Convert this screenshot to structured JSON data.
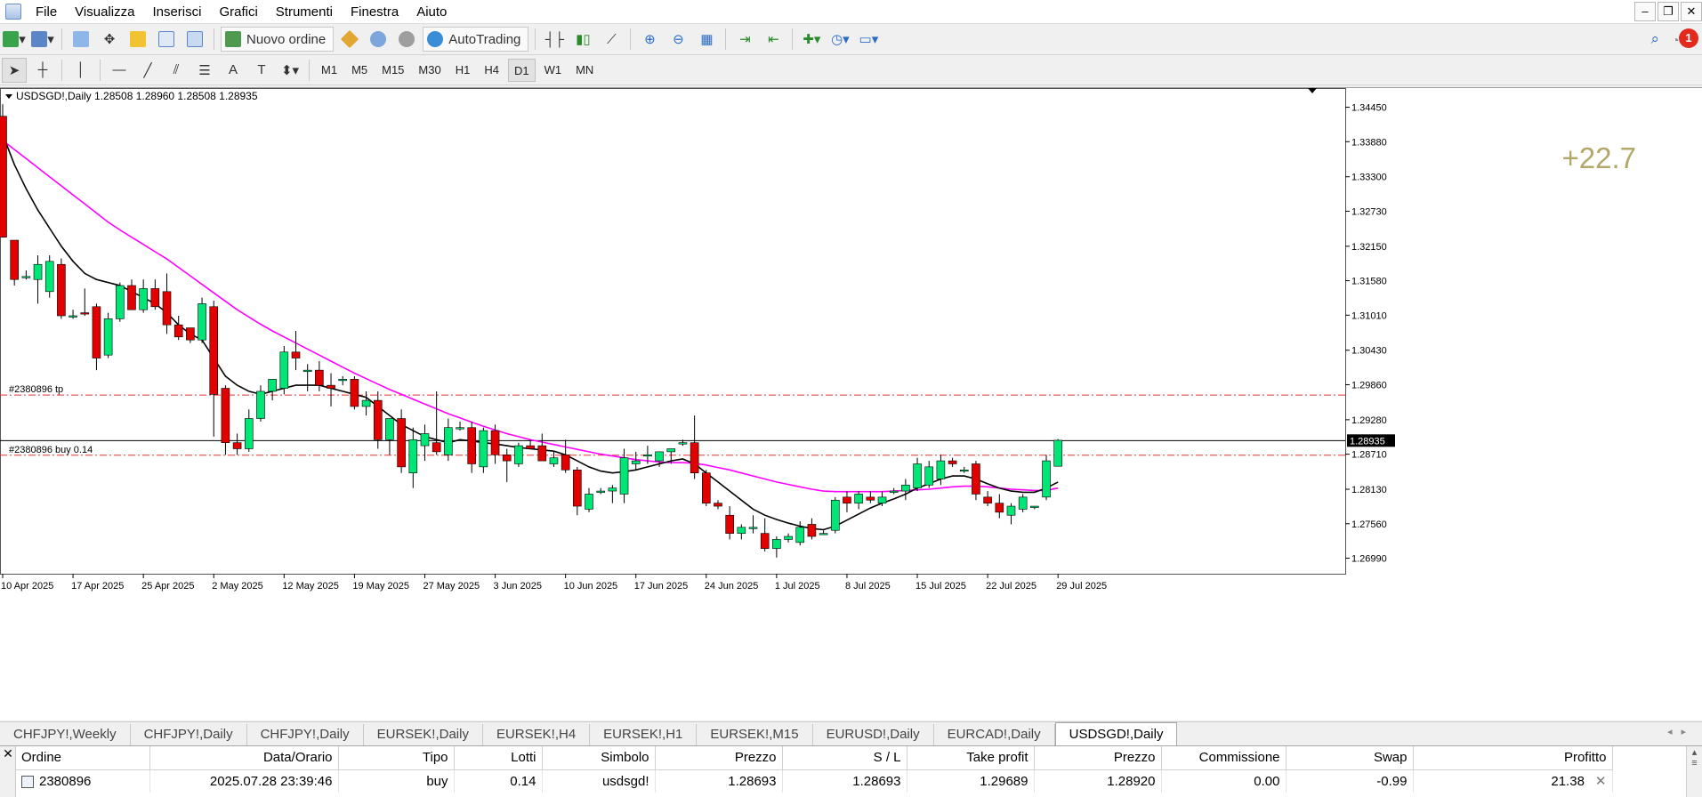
{
  "menu": {
    "items": [
      "File",
      "Visualizza",
      "Inserisci",
      "Grafici",
      "Strumenti",
      "Finestra",
      "Aiuto"
    ]
  },
  "window_buttons": [
    "minimize-icon",
    "restore-icon",
    "close-icon"
  ],
  "toolbar1": {
    "new_order_label": "Nuovo ordine",
    "autotrading_label": "AutoTrading",
    "notification_count": "1"
  },
  "toolbar2": {
    "timeframes": [
      "M1",
      "M5",
      "M15",
      "M30",
      "H1",
      "H4",
      "D1",
      "W1",
      "MN"
    ],
    "active_timeframe": "D1"
  },
  "chart": {
    "header": "USDSGD!,Daily  1.28508 1.28960 1.28508 1.28935",
    "profit_label": "+22.7",
    "tp_label": "#2380896 tp",
    "buy_label": "#2380896 buy 0.14",
    "current_price": "1.28935"
  },
  "chart_data": {
    "type": "candlestick",
    "symbol": "USDSGD!",
    "timeframe": "Daily",
    "y_ticks": [
      "1.34450",
      "1.33880",
      "1.33300",
      "1.32730",
      "1.32150",
      "1.31580",
      "1.31010",
      "1.30430",
      "1.29860",
      "1.29280",
      "1.28710",
      "1.28130",
      "1.27560",
      "1.26990"
    ],
    "ylim": [
      1.2685,
      1.3462
    ],
    "x_ticks": [
      "10 Apr 2025",
      "17 Apr 2025",
      "25 Apr 2025",
      "2 May 2025",
      "12 May 2025",
      "19 May 2025",
      "27 May 2025",
      "3 Jun 2025",
      "10 Jun 2025",
      "17 Jun 2025",
      "24 Jun 2025",
      "1 Jul 2025",
      "8 Jul 2025",
      "15 Jul 2025",
      "22 Jul 2025",
      "29 Jul 2025"
    ],
    "x_tick_index": [
      0,
      6,
      12,
      18,
      24,
      30,
      36,
      42,
      48,
      54,
      60,
      66,
      72,
      78,
      84,
      90
    ],
    "candles": [
      [
        1.343,
        1.345,
        1.3415,
        1.323
      ],
      [
        1.3225,
        1.322,
        1.315,
        1.316
      ],
      [
        1.3165,
        1.3175,
        1.316,
        1.3165
      ],
      [
        1.316,
        1.32,
        1.312,
        1.3185
      ],
      [
        1.314,
        1.32,
        1.313,
        1.319
      ],
      [
        1.3185,
        1.3195,
        1.3095,
        1.31
      ],
      [
        1.31,
        1.311,
        1.3095,
        1.31
      ],
      [
        1.3105,
        1.3145,
        1.31,
        1.3103
      ],
      [
        1.3115,
        1.312,
        1.301,
        1.303
      ],
      [
        1.3035,
        1.3105,
        1.303,
        1.3095
      ],
      [
        1.3095,
        1.3155,
        1.309,
        1.315
      ],
      [
        1.315,
        1.316,
        1.311,
        1.311
      ],
      [
        1.311,
        1.316,
        1.3105,
        1.3145
      ],
      [
        1.3145,
        1.316,
        1.311,
        1.3115
      ],
      [
        1.314,
        1.317,
        1.307,
        1.3085
      ],
      [
        1.3085,
        1.31,
        1.306,
        1.3065
      ],
      [
        1.308,
        1.308,
        1.3055,
        1.306
      ],
      [
        1.306,
        1.313,
        1.3055,
        1.312
      ],
      [
        1.3115,
        1.3125,
        1.29,
        1.297
      ],
      [
        1.298,
        1.2985,
        1.287,
        1.289
      ],
      [
        1.289,
        1.2905,
        1.287,
        1.288
      ],
      [
        1.288,
        1.2945,
        1.2875,
        1.293
      ],
      [
        1.293,
        1.2985,
        1.2925,
        1.2975
      ],
      [
        1.2975,
        1.2995,
        1.296,
        1.2995
      ],
      [
        1.298,
        1.305,
        1.297,
        1.304
      ],
      [
        1.304,
        1.3075,
        1.301,
        1.303
      ],
      [
        1.301,
        1.302,
        1.2975,
        1.301
      ],
      [
        1.301,
        1.3025,
        1.2975,
        1.2985
      ],
      [
        1.2985,
        1.3005,
        1.295,
        1.298
      ],
      [
        1.2995,
        1.3,
        1.2985,
        1.2995
      ],
      [
        1.2995,
        1.3,
        1.2945,
        1.295
      ],
      [
        1.295,
        1.2975,
        1.2935,
        1.296
      ],
      [
        1.296,
        1.2975,
        1.288,
        1.2895
      ],
      [
        1.2895,
        1.293,
        1.287,
        1.293
      ],
      [
        1.293,
        1.2945,
        1.284,
        1.285
      ],
      [
        1.284,
        1.2915,
        1.2815,
        1.2895
      ],
      [
        1.2885,
        1.292,
        1.286,
        1.2905
      ],
      [
        1.289,
        1.2975,
        1.287,
        1.2875
      ],
      [
        1.287,
        1.293,
        1.286,
        1.2915
      ],
      [
        1.2915,
        1.2925,
        1.291,
        1.2915
      ],
      [
        1.2915,
        1.2925,
        1.284,
        1.2855
      ],
      [
        1.285,
        1.2915,
        1.284,
        1.291
      ],
      [
        1.291,
        1.292,
        1.2855,
        1.287
      ],
      [
        1.287,
        1.288,
        1.2825,
        1.286
      ],
      [
        1.2855,
        1.289,
        1.285,
        1.2885
      ],
      [
        1.2885,
        1.2895,
        1.288,
        1.288
      ],
      [
        1.2885,
        1.2905,
        1.286,
        1.286
      ],
      [
        1.2855,
        1.2875,
        1.285,
        1.2865
      ],
      [
        1.287,
        1.2895,
        1.284,
        1.2845
      ],
      [
        1.2845,
        1.285,
        1.277,
        1.2785
      ],
      [
        1.278,
        1.2815,
        1.2775,
        1.2805
      ],
      [
        1.281,
        1.2815,
        1.2805,
        1.281
      ],
      [
        1.281,
        1.282,
        1.279,
        1.2815
      ],
      [
        1.2805,
        1.288,
        1.279,
        1.2865
      ],
      [
        1.2855,
        1.2875,
        1.2845,
        1.286
      ],
      [
        1.287,
        1.2885,
        1.2855,
        1.287
      ],
      [
        1.286,
        1.2875,
        1.285,
        1.2875
      ],
      [
        1.2875,
        1.288,
        1.2855,
        1.288
      ],
      [
        1.289,
        1.2895,
        1.2885,
        1.289
      ],
      [
        1.289,
        1.2935,
        1.283,
        1.284
      ],
      [
        1.284,
        1.2845,
        1.2785,
        1.279
      ],
      [
        1.279,
        1.2795,
        1.278,
        1.2785
      ],
      [
        1.277,
        1.2785,
        1.273,
        1.274
      ],
      [
        1.274,
        1.2755,
        1.273,
        1.275
      ],
      [
        1.275,
        1.277,
        1.274,
        1.275
      ],
      [
        1.274,
        1.2765,
        1.271,
        1.2715
      ],
      [
        1.2715,
        1.2735,
        1.27,
        1.273
      ],
      [
        1.273,
        1.274,
        1.2725,
        1.2735
      ],
      [
        1.2725,
        1.276,
        1.272,
        1.275
      ],
      [
        1.2755,
        1.2765,
        1.273,
        1.2735
      ],
      [
        1.274,
        1.2745,
        1.2738,
        1.274
      ],
      [
        1.2745,
        1.28,
        1.274,
        1.2795
      ],
      [
        1.28,
        1.281,
        1.2775,
        1.279
      ],
      [
        1.279,
        1.281,
        1.278,
        1.2805
      ],
      [
        1.28,
        1.281,
        1.279,
        1.2795
      ],
      [
        1.279,
        1.281,
        1.2785,
        1.28
      ],
      [
        1.281,
        1.2815,
        1.2805,
        1.281
      ],
      [
        1.281,
        1.283,
        1.2795,
        1.282
      ],
      [
        1.2815,
        1.2865,
        1.281,
        1.2855
      ],
      [
        1.282,
        1.286,
        1.2815,
        1.285
      ],
      [
        1.283,
        1.287,
        1.282,
        1.286
      ],
      [
        1.286,
        1.2865,
        1.285,
        1.2855
      ],
      [
        1.2845,
        1.285,
        1.284,
        1.2845
      ],
      [
        1.2855,
        1.286,
        1.2795,
        1.2805
      ],
      [
        1.28,
        1.281,
        1.2785,
        1.279
      ],
      [
        1.279,
        1.2805,
        1.2765,
        1.2775
      ],
      [
        1.277,
        1.279,
        1.2755,
        1.2785
      ],
      [
        1.278,
        1.2805,
        1.2775,
        1.28
      ],
      [
        1.2785,
        1.2785,
        1.278,
        1.2785
      ],
      [
        1.28,
        1.287,
        1.2795,
        1.286
      ],
      [
        1.2851,
        1.2896,
        1.2851,
        1.2894
      ]
    ],
    "ma_fast": [
      1.34,
      1.335,
      1.331,
      1.3275,
      1.3245,
      1.3215,
      1.319,
      1.317,
      1.316,
      1.3155,
      1.315,
      1.314,
      1.313,
      1.312,
      1.3105,
      1.3085,
      1.307,
      1.306,
      1.303,
      1.3,
      1.2985,
      1.2975,
      1.297,
      1.2975,
      1.298,
      1.2985,
      1.2985,
      1.2985,
      1.298,
      1.2975,
      1.297,
      1.2965,
      1.295,
      1.2935,
      1.292,
      1.291,
      1.29,
      1.2895,
      1.289,
      1.2895,
      1.2893,
      1.289,
      1.2888,
      1.2885,
      1.2882,
      1.288,
      1.2878,
      1.2876,
      1.287,
      1.286,
      1.285,
      1.2843,
      1.284,
      1.2842,
      1.2845,
      1.285,
      1.2855,
      1.286,
      1.2863,
      1.2855,
      1.284,
      1.2825,
      1.281,
      1.2795,
      1.278,
      1.277,
      1.2763,
      1.2757,
      1.2752,
      1.2748,
      1.2746,
      1.2752,
      1.2762,
      1.2772,
      1.2782,
      1.279,
      1.2797,
      1.2805,
      1.2815,
      1.2822,
      1.283,
      1.2835,
      1.2835,
      1.283,
      1.2822,
      1.2815,
      1.281,
      1.2808,
      1.2808,
      1.2815,
      1.2825
    ],
    "ma_slow": [
      1.339,
      1.3375,
      1.336,
      1.3345,
      1.333,
      1.3315,
      1.33,
      1.3285,
      1.327,
      1.3255,
      1.3242,
      1.323,
      1.3218,
      1.3206,
      1.3194,
      1.318,
      1.3166,
      1.3152,
      1.3138,
      1.3124,
      1.311,
      1.3098,
      1.3086,
      1.3075,
      1.3065,
      1.3055,
      1.3045,
      1.3035,
      1.3025,
      1.3015,
      1.3005,
      1.2996,
      1.2987,
      1.2978,
      1.297,
      1.2962,
      1.2954,
      1.2946,
      1.2938,
      1.2931,
      1.2924,
      1.2917,
      1.2911,
      1.2905,
      1.29,
      1.2895,
      1.2891,
      1.2887,
      1.2883,
      1.2879,
      1.2875,
      1.2871,
      1.2868,
      1.2865,
      1.2862,
      1.286,
      1.2858,
      1.2857,
      1.2857,
      1.2856,
      1.2853,
      1.2849,
      1.2845,
      1.284,
      1.2835,
      1.283,
      1.2825,
      1.2821,
      1.2817,
      1.2813,
      1.281,
      1.2809,
      1.2809,
      1.2809,
      1.2809,
      1.2809,
      1.281,
      1.2811,
      1.2812,
      1.2813,
      1.2815,
      1.2817,
      1.2818,
      1.2818,
      1.2817,
      1.2815,
      1.2813,
      1.2812,
      1.2811,
      1.2811,
      1.2815
    ],
    "levels": {
      "take_profit": 1.29689,
      "entry": 1.28693,
      "current": 1.28935
    },
    "colors": {
      "bull": "#00e676",
      "bear": "#e10000",
      "ma_fast": "#000000",
      "ma_slow": "#ff00ff",
      "level": "#e83030",
      "profit_text": "#b3a76a"
    },
    "grid": false
  },
  "chart_tabs": [
    "CHFJPY!,Weekly",
    "CHFJPY!,Daily",
    "CHFJPY!,Daily",
    "EURSEK!,Daily",
    "EURSEK!,H4",
    "EURSEK!,H1",
    "EURSEK!,M15",
    "EURUSD!,Daily",
    "EURCAD!,Daily",
    "USDSGD!,Daily"
  ],
  "active_tab_index": 9,
  "terminal": {
    "columns": [
      "Ordine",
      "Data/Orario",
      "Tipo",
      "Lotti",
      "Simbolo",
      "Prezzo",
      "S / L",
      "Take profit",
      "Prezzo",
      "Commissione",
      "Swap",
      "Profitto"
    ],
    "rows": [
      [
        "2380896",
        "2025.07.28 23:39:46",
        "buy",
        "0.14",
        "usdsgd!",
        "1.28693",
        "1.28693",
        "1.29689",
        "1.28920",
        "0.00",
        "-0.99",
        "21.38"
      ]
    ]
  }
}
